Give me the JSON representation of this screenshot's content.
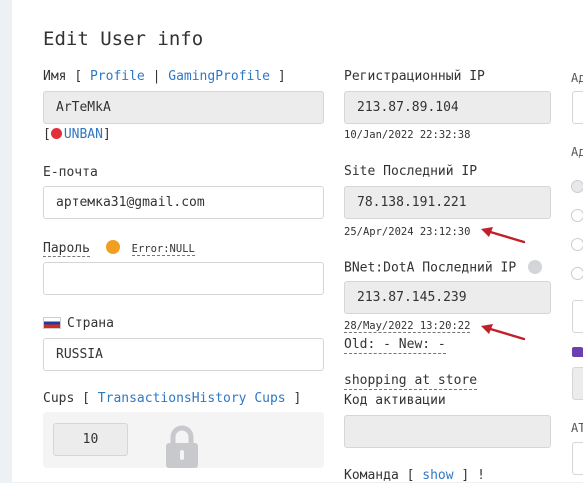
{
  "page": {
    "title": "Edit User info"
  },
  "name_section": {
    "label": "Имя",
    "bracket_open": "[",
    "separator": "|",
    "bracket_close": "]",
    "profile_link": "Profile",
    "gaming_profile_link": "GamingProfile",
    "value": "ArTeMkA",
    "unban_open": "[",
    "unban_link": "UNBAN",
    "unban_close": "]"
  },
  "email_section": {
    "label": "E-почта",
    "value": "артемка31@gmail.com"
  },
  "password_section": {
    "label": "Пароль",
    "error_text": "Error:NULL",
    "value": ""
  },
  "country_section": {
    "label": "Страна",
    "value": "RUSSIA"
  },
  "cups_section": {
    "label": "Cups",
    "bracket_open": "[",
    "link": "TransactionsHistory Cups",
    "bracket_close": "]",
    "value": "10"
  },
  "registration_ip": {
    "label": "Регистрационный IP",
    "value": "213.87.89.104",
    "date": "10/Jan/2022 22:32:38"
  },
  "site_last_ip": {
    "label": "Site Последний IP",
    "value": "78.138.191.221",
    "date": "25/Apr/2024 23:12:30"
  },
  "bnet_last_ip": {
    "label": "BNet:DotA Последний IP",
    "value": "213.87.145.239",
    "date": "28/May/2022 13:20:22",
    "old_new": "Old: - New: -"
  },
  "shopping": {
    "link": "shopping at store"
  },
  "activation": {
    "label": "Код активации",
    "value": ""
  },
  "team": {
    "label": "Команда",
    "bracket_open": "[",
    "link": "show",
    "bracket_close": "]",
    "suffix": "!"
  },
  "right_edge": {
    "label_a1": "Ад",
    "label_a2": "Ад",
    "label_a3": "АТ"
  },
  "colors": {
    "link": "#2f78c4",
    "arrow": "#c0202a",
    "unban_dot": "#e0303a",
    "error_dot": "#f0a020",
    "status_dot": "#d3d5d8",
    "lock": "#c7c9cc"
  }
}
